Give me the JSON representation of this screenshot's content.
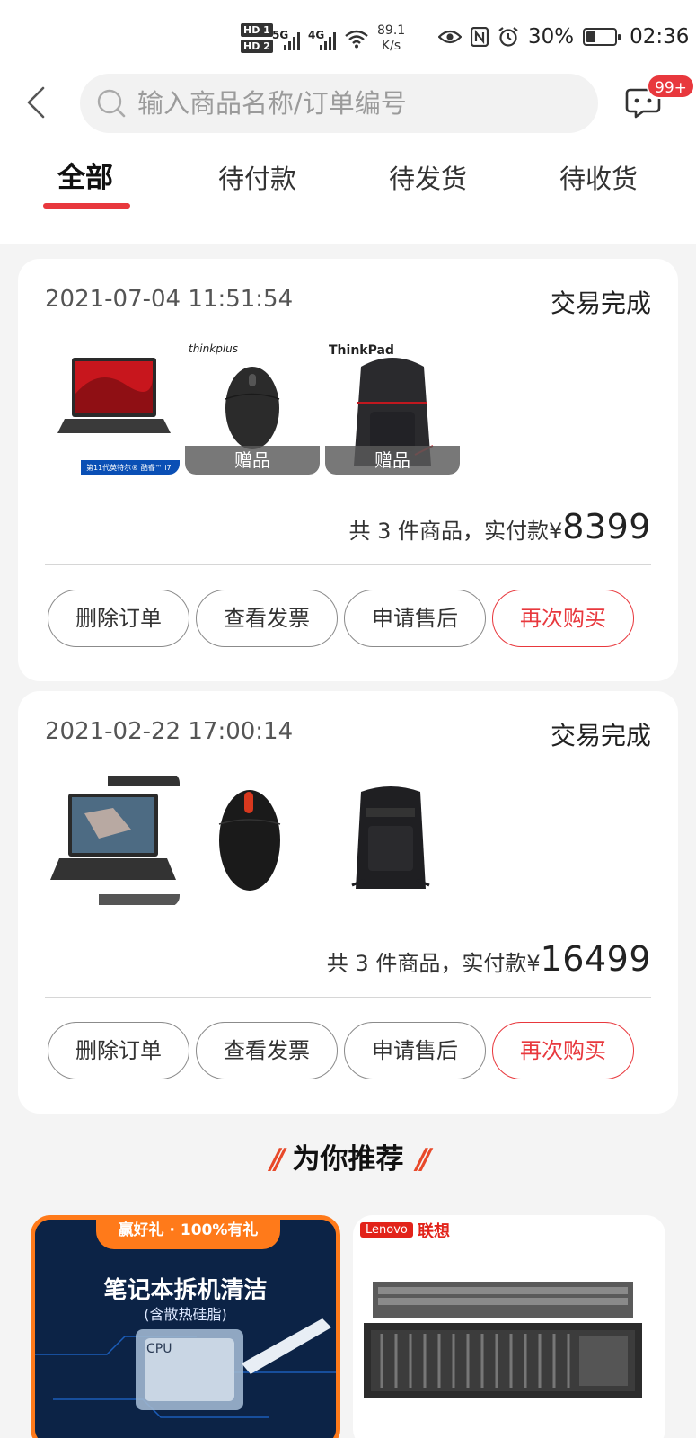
{
  "status_bar": {
    "hd1": "HD 1",
    "hd2": "HD 2",
    "net1": "5G",
    "net2": "4G",
    "speed_value": "89.1",
    "speed_unit": "K/s",
    "battery": "30%",
    "time": "02:36"
  },
  "header": {
    "search_placeholder": "输入商品名称/订单编号",
    "message_badge": "99+"
  },
  "tabs": [
    {
      "label": "全部",
      "active": true
    },
    {
      "label": "待付款",
      "active": false
    },
    {
      "label": "待发货",
      "active": false
    },
    {
      "label": "待收货",
      "active": false
    }
  ],
  "orders": [
    {
      "time": "2021-07-04 11:51:54",
      "status": "交易完成",
      "products": [
        {
          "name": "laptop-image",
          "badge": "",
          "brand": "",
          "banner": "第11代英特尔® 酷睿™ i7"
        },
        {
          "name": "thinkplus-mouse-image",
          "badge": "赠品",
          "brand": "thinkplus"
        },
        {
          "name": "thinkpad-backpack-image",
          "badge": "赠品",
          "brand": "ThinkPad"
        }
      ],
      "total_prefix": "共 3 件商品，实付款 ",
      "currency": "¥",
      "amount": "8399",
      "buttons": [
        "删除订单",
        "查看发票",
        "申请售后",
        "再次购买"
      ]
    },
    {
      "time": "2021-02-22 17:00:14",
      "status": "交易完成",
      "products": [
        {
          "name": "workstation-laptop-image",
          "badge": "",
          "brand": ""
        },
        {
          "name": "thinkpad-mouse-image",
          "badge": "",
          "brand": ""
        },
        {
          "name": "backpack-image",
          "badge": "",
          "brand": ""
        }
      ],
      "total_prefix": "共 3 件商品，实付款 ",
      "currency": "¥",
      "amount": "16499",
      "buttons": [
        "删除订单",
        "查看发票",
        "申请售后",
        "再次购买"
      ]
    }
  ],
  "recommend": {
    "title": "为你推荐",
    "items": [
      {
        "ribbon": "赢好礼 · 100%有礼",
        "headline": "笔记本拆机清洁",
        "subline": "(含散热硅脂)",
        "chip_label": "CPU"
      },
      {
        "brand_logo": "Lenovo",
        "brand_cn": "联想"
      }
    ]
  },
  "colors": {
    "accent": "#e8383d",
    "background": "#f4f4f4",
    "orange": "#ff7a1a"
  }
}
